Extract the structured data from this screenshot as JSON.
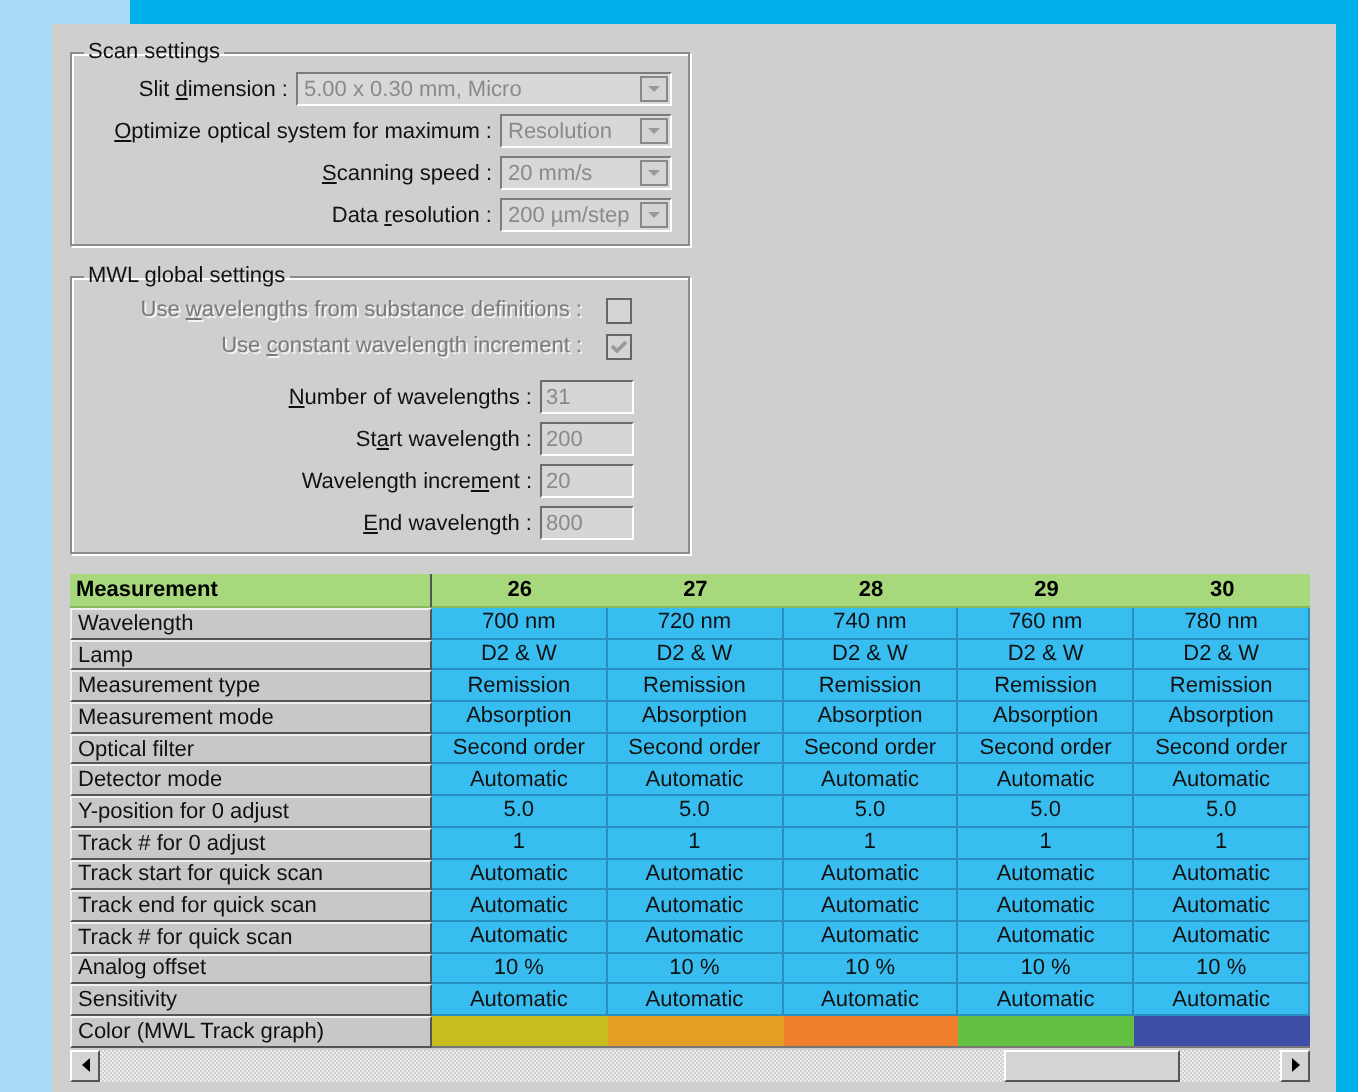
{
  "scan_settings": {
    "title": "Scan settings",
    "fields": [
      {
        "label": {
          "pre": "Slit ",
          "key": "d",
          "post": "imension :"
        },
        "value": "5.00 x 0.30 mm, Micro",
        "wide": true,
        "disabled": true
      },
      {
        "label": {
          "key": "O",
          "post": "ptimize optical system for maximum :"
        },
        "value": "Resolution",
        "wide": false,
        "disabled": true
      },
      {
        "label": {
          "key": "S",
          "post": "canning speed :"
        },
        "value": "20 mm/s",
        "wide": false,
        "disabled": true
      },
      {
        "label": {
          "pre": "Data ",
          "key": "r",
          "post": "esolution :"
        },
        "value": "200 µm/step",
        "wide": false,
        "disabled": true
      }
    ]
  },
  "mwl_settings": {
    "title": "MWL global settings",
    "options": [
      {
        "label": {
          "pre": "Use ",
          "key": "w",
          "post": "avelengths from substance definitions :"
        },
        "checked": false,
        "disabled": true
      },
      {
        "label": {
          "pre": "Use ",
          "key": "c",
          "post": "onstant wavelength increment :"
        },
        "checked": true,
        "disabled": true
      }
    ],
    "fields": [
      {
        "label": {
          "key": "N",
          "post": "umber of wavelengths :"
        },
        "value": "31",
        "disabled": true
      },
      {
        "label": {
          "pre": "St",
          "key": "a",
          "post": "rt wavelength :"
        },
        "value": "200",
        "disabled": true
      },
      {
        "label": {
          "pre": "Wavelength incre",
          "key": "m",
          "post": "ent :"
        },
        "value": "20",
        "disabled": true
      },
      {
        "label": {
          "key": "E",
          "post": "nd wavelength :"
        },
        "value": "800",
        "disabled": true
      }
    ]
  },
  "table": {
    "header": {
      "label": "Measurement",
      "columns": [
        "26",
        "27",
        "28",
        "29",
        "30"
      ]
    },
    "rows": [
      {
        "kind": "text",
        "label": "Wavelength",
        "cells": [
          "700 nm",
          "720 nm",
          "740 nm",
          "760 nm",
          "780 nm"
        ]
      },
      {
        "kind": "text",
        "label": "Lamp",
        "cells": [
          "D2 & W",
          "D2 & W",
          "D2 & W",
          "D2 & W",
          "D2 & W"
        ]
      },
      {
        "kind": "text",
        "label": "Measurement type",
        "cells": [
          "Remission",
          "Remission",
          "Remission",
          "Remission",
          "Remission"
        ]
      },
      {
        "kind": "text",
        "label": "Measurement mode",
        "cells": [
          "Absorption",
          "Absorption",
          "Absorption",
          "Absorption",
          "Absorption"
        ]
      },
      {
        "kind": "text",
        "label": "Optical filter",
        "cells": [
          "Second order",
          "Second order",
          "Second order",
          "Second order",
          "Second order"
        ]
      },
      {
        "kind": "text",
        "label": "Detector mode",
        "cells": [
          "Automatic",
          "Automatic",
          "Automatic",
          "Automatic",
          "Automatic"
        ]
      },
      {
        "kind": "text",
        "label": "Y-position for 0 adjust",
        "cells": [
          "5.0",
          "5.0",
          "5.0",
          "5.0",
          "5.0"
        ]
      },
      {
        "kind": "text",
        "label": "Track # for 0 adjust",
        "cells": [
          "1",
          "1",
          "1",
          "1",
          "1"
        ]
      },
      {
        "kind": "text",
        "label": "Track start for quick scan",
        "cells": [
          "Automatic",
          "Automatic",
          "Automatic",
          "Automatic",
          "Automatic"
        ]
      },
      {
        "kind": "text",
        "label": "Track end for quick scan",
        "cells": [
          "Automatic",
          "Automatic",
          "Automatic",
          "Automatic",
          "Automatic"
        ]
      },
      {
        "kind": "text",
        "label": "Track # for quick scan",
        "cells": [
          "Automatic",
          "Automatic",
          "Automatic",
          "Automatic",
          "Automatic"
        ]
      },
      {
        "kind": "text",
        "label": "Analog offset",
        "cells": [
          "10 %",
          "10 %",
          "10 %",
          "10 %",
          "10 %"
        ]
      },
      {
        "kind": "text",
        "label": "Sensitivity",
        "cells": [
          "Automatic",
          "Automatic",
          "Automatic",
          "Automatic",
          "Automatic"
        ]
      },
      {
        "kind": "color",
        "label": "Color (MWL Track graph)",
        "cells": [
          {
            "color": "#c8bc20"
          },
          {
            "color": "#e4a024"
          },
          {
            "color": "#f0802c"
          },
          {
            "color": "#64c040"
          },
          {
            "color": "#3e4ea6"
          }
        ]
      }
    ]
  }
}
